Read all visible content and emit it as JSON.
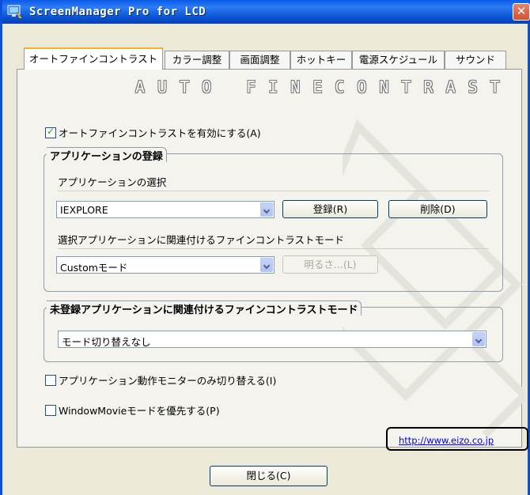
{
  "window": {
    "title": "ScreenManager Pro for LCD",
    "close": "✕"
  },
  "tabs": [
    {
      "label": "オートファインコントラスト",
      "active": true
    },
    {
      "label": "カラー調整"
    },
    {
      "label": "画面調整"
    },
    {
      "label": "ホットキー"
    },
    {
      "label": "電源スケジュール"
    },
    {
      "label": "サウンド"
    }
  ],
  "banner": "AUTO FINECONTRAST",
  "enable_checkbox": {
    "label": "オートファインコントラストを有効にする(A)",
    "checked": true
  },
  "app_registration": {
    "title": "アプリケーションの登録",
    "select_label": "アプリケーションの選択",
    "app_value": "IEXPLORE",
    "register_button": "登録(R)",
    "delete_button": "削除(D)",
    "mode_label": "選択アプリケーションに関連付けるファインコントラストモード",
    "mode_value": "Customモード",
    "brightness_button": "明るさ...(L)"
  },
  "unregistered": {
    "title": "未登録アプリケーションに関連付けるファインコントラストモード",
    "mode_value": "モード切り替えなし"
  },
  "monitor_only_checkbox": {
    "label": "アプリケーション動作モニターのみ切り替える(I)",
    "checked": false
  },
  "windowmovie_checkbox": {
    "label": "WindowMovieモードを優先する(P)",
    "checked": false
  },
  "link": "http://www.eizo.co.jp",
  "close_button": "閉じる(C)",
  "colors": {
    "titlebar": "#0a5ae8",
    "tab_active_top": "#f9b02b",
    "link": "#0000ee"
  }
}
